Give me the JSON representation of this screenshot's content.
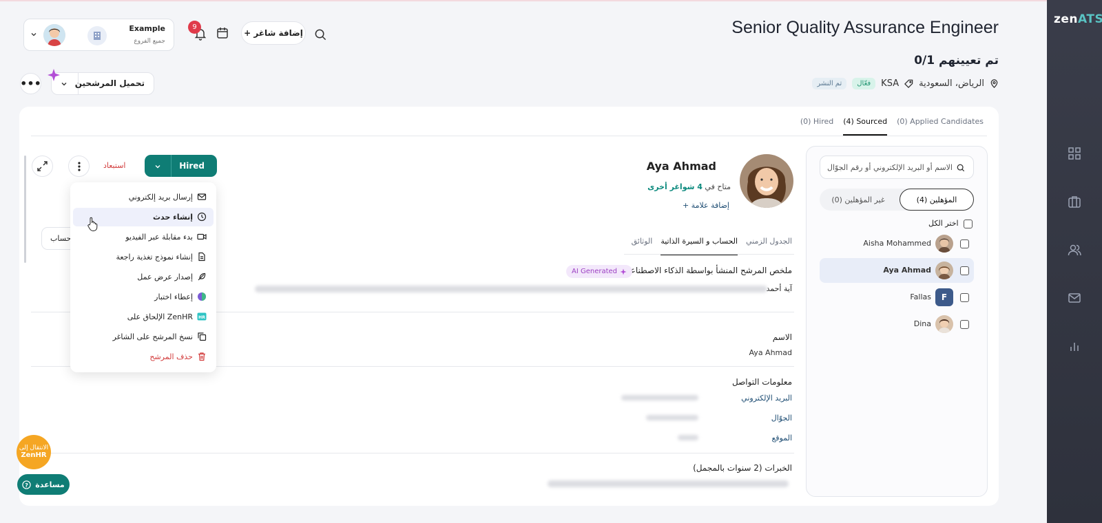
{
  "brand": {
    "logo_main": "zen",
    "logo_accent": "ATS"
  },
  "header": {
    "job_title": "Senior Quality Assurance Engineer",
    "assigned": "0/1 تم تعيينهم",
    "location": "الرياض، السعودية",
    "tag": "KSA",
    "status_active": "فعّال",
    "status_published": "تم النشر"
  },
  "user": {
    "company": "Example",
    "branches": "جميع الفروع"
  },
  "toolbar": {
    "add_position": "+ إضافة شاغر",
    "notifications_count": "9",
    "load_candidates": "تحميل المرشحين",
    "more": "•••"
  },
  "pipeline_tabs": [
    "(0) Applied Candidates",
    "(4) Sourced",
    "(0) Hired"
  ],
  "candidate_panel": {
    "search_placeholder": "الاسم أو البريد الإلكتروني أو رقم الجوّال",
    "qualified": "المؤهلين (4)",
    "unqualified": "غير المؤهلين (0)",
    "select_all": "اختر الكل",
    "candidates": [
      {
        "name": "Aisha Mohammed",
        "initial": ""
      },
      {
        "name": "Aya Ahmad",
        "initial": ""
      },
      {
        "name": "Fallas",
        "initial": "F"
      },
      {
        "name": "Dina",
        "initial": ""
      }
    ]
  },
  "profile": {
    "name": "Aya Ahmad",
    "availability_prefix": "متاح في",
    "availability_value": "4 شواغر أخرى",
    "add_tag": "+ إضافة علامة",
    "tabs": [
      "الجدول الزمني",
      "الحساب و السيرة الذاتية",
      "الوثائق"
    ],
    "ai_summary_title": "ملخص المرشح المنشأ بواسطة الذكاء الاصطناعي",
    "ai_badge": "AI Generated",
    "ai_summary_start": "آية أحمد",
    "name_label": "الاسم",
    "name_value": "Aya Ahmad",
    "contact_title": "معلومات التواصل",
    "email_label": "البريد الإلكتروني",
    "mobile_label": "الجوّال",
    "location_label": "الموقع",
    "experience_title": "الخبرات (2 سنوات بالمجمل)"
  },
  "actions": {
    "hired": "Hired",
    "exclude": "استبعاد",
    "account_fragment": "حساب"
  },
  "menu": [
    {
      "label": "إرسال بريد إلكتروني",
      "icon": "mail-icon"
    },
    {
      "label": "إنشاء حدث",
      "icon": "clock-icon"
    },
    {
      "label": "بدء مقابلة عبر الفيديو",
      "icon": "video-icon"
    },
    {
      "label": "إنشاء نموذج تغذية راجعة",
      "icon": "document-icon"
    },
    {
      "label": "إصدار عرض عمل",
      "icon": "feather-icon"
    },
    {
      "label": "إعطاء اختبار",
      "icon": "test-icon"
    },
    {
      "label": "الإلحاق على ZenHR",
      "icon": "zenhr-icon"
    },
    {
      "label": "نسخ المرشح على الشاغر",
      "icon": "copy-icon"
    },
    {
      "label": "حذف المرشح",
      "icon": "trash-icon"
    }
  ],
  "floating": {
    "zenhr_line1": "الانتقال إلى",
    "zenhr_line2": "ZenHR",
    "help": "مساعدة"
  },
  "colors": {
    "primary": "#0f7d75",
    "danger": "#d23b3b",
    "sidebar": "#2e313c",
    "accent": "#f5a623"
  }
}
